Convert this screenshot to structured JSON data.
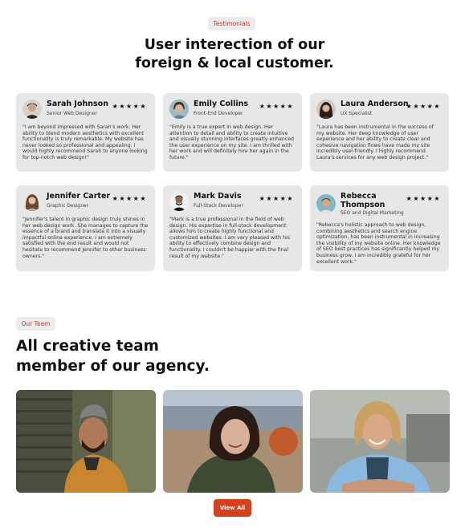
{
  "testimonials": {
    "badge": "Testimonials",
    "heading_line1": "User interection of our",
    "heading_line2": "foreign & local customer.",
    "stars": "★★★★★",
    "cards": [
      {
        "name": "Sarah Johnson",
        "role": "Senior Web Designer",
        "text": "\"I am beyond impressed with Sarah's work. Her ability to blend modern aesthetics with excellent functionality is truly remarkable. My website has never looked so professional and appealing. I would highly recommend Sarah to anyone looking for top-notch web design!\""
      },
      {
        "name": "Emily Collins",
        "role": "Front-End Developer",
        "text": "\"Emily is a true expert in web design. Her attention to detail and ability to create intuitive and visually stunning interfaces greatly enhanced the user experience on my site. I am thrilled with her work and will definitely hire her again in the future.\""
      },
      {
        "name": "Laura Anderson",
        "role": "UX Specialist",
        "text": "\"Laura has been instrumental in the success of my website. Her deep knowledge of user experience and her ability to create clear and cohesive navigation flows have made my site incredibly user-friendly. I highly recommend Laura's services for any web design project.\""
      },
      {
        "name": "Jennifer Carter",
        "role": "Graphic Designer",
        "text": "\"Jennifer's talent in graphic design truly shines in her web design work. She manages to capture the essence of a brand and translate it into a visually impactful online experience. I am extremely satisfied with the end result and would not hesitate to recommend Jennifer to other business owners.\""
      },
      {
        "name": "Mark Davis",
        "role": "Full-Stack Developer",
        "text": "\"Mark is a true professional in the field of web design. His expertise in full-stack development allows him to create highly functional and customized websites. I am very pleased with his ability to effectively combine design and functionality. I couldn't be happier with the final result of my website.\""
      },
      {
        "name_line1": "Rebecca",
        "name_line2": "Thompson",
        "role": "SEO and Digital Marketing",
        "text": "\"Rebecca's holistic approach to web design, combining aesthetics and search engine optimization, has been instrumental in increasing the visibility of my website online. Her knowledge of SEO best practices has significantly helped my business grow. I am incredibly grateful for her excellent work.\""
      }
    ]
  },
  "team": {
    "badge": "Our Team",
    "heading_line1": "All creative team",
    "heading_line2": "member of our agency.",
    "view_all_label": "View All"
  },
  "colors": {
    "accent": "#d6411d",
    "badge_text": "#c0392b",
    "card_bg": "#e7e7e7"
  }
}
